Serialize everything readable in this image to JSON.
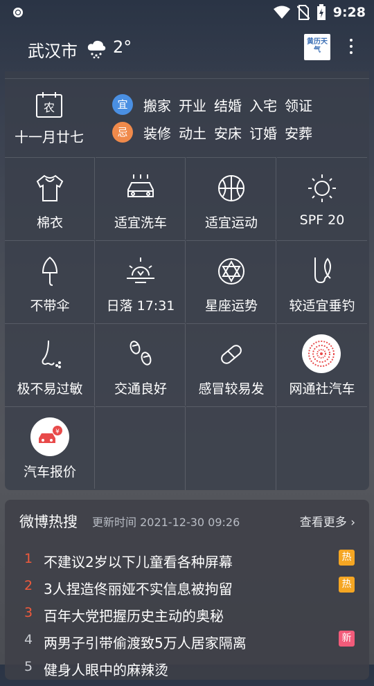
{
  "status_bar": {
    "time": "9:28"
  },
  "header": {
    "city": "武汉市",
    "temperature": "2°",
    "weather_icon": "snow-cloud-icon",
    "logo_text": "黄历天气"
  },
  "almanac": {
    "calendar_char": "农",
    "lunar_date": "十一月廿七",
    "yi_label": "宜",
    "ji_label": "忌",
    "yi_items": [
      "搬家",
      "开业",
      "结婚",
      "入宅",
      "领证"
    ],
    "ji_items": [
      "装修",
      "动土",
      "安床",
      "订婚",
      "安葬"
    ],
    "colors": {
      "yi": "#4a8fe2",
      "ji": "#f08a4b"
    }
  },
  "life_index": [
    {
      "icon": "cotton-coat-icon",
      "label": "棉衣"
    },
    {
      "icon": "car-wash-icon",
      "label": "适宜洗车"
    },
    {
      "icon": "basketball-icon",
      "label": "适宜运动"
    },
    {
      "icon": "sun-icon",
      "label": "SPF 20"
    },
    {
      "icon": "umbrella-icon",
      "label": "不带伞"
    },
    {
      "icon": "sunset-icon",
      "label": "日落 17:31"
    },
    {
      "icon": "constellation-icon",
      "label": "星座运势"
    },
    {
      "icon": "fishing-icon",
      "label": "较适宜垂钓"
    },
    {
      "icon": "nose-allergy-icon",
      "label": "极不易过敏"
    },
    {
      "icon": "footprints-icon",
      "label": "交通良好"
    },
    {
      "icon": "pill-icon",
      "label": "感冒较易发"
    },
    {
      "icon": "wangtong-logo-icon",
      "label": "网通社汽车"
    },
    {
      "icon": "car-price-icon",
      "label": "汽车报价"
    }
  ],
  "hot_search": {
    "title": "微博热搜",
    "updated": "更新时间 2021-12-30 09:26",
    "more": "查看更多",
    "items": [
      {
        "rank": "1",
        "text": "不建议2岁以下儿童看各种屏幕",
        "tag": "热"
      },
      {
        "rank": "2",
        "text": "3人捏造佟丽娅不实信息被拘留",
        "tag": "热"
      },
      {
        "rank": "3",
        "text": "百年大党把握历史主动的奥秘",
        "tag": ""
      },
      {
        "rank": "4",
        "text": "两男子引带偷渡致5万人居家隔离",
        "tag": "新"
      },
      {
        "rank": "5",
        "text": "健身人眼中的麻辣烫",
        "tag": ""
      }
    ]
  }
}
